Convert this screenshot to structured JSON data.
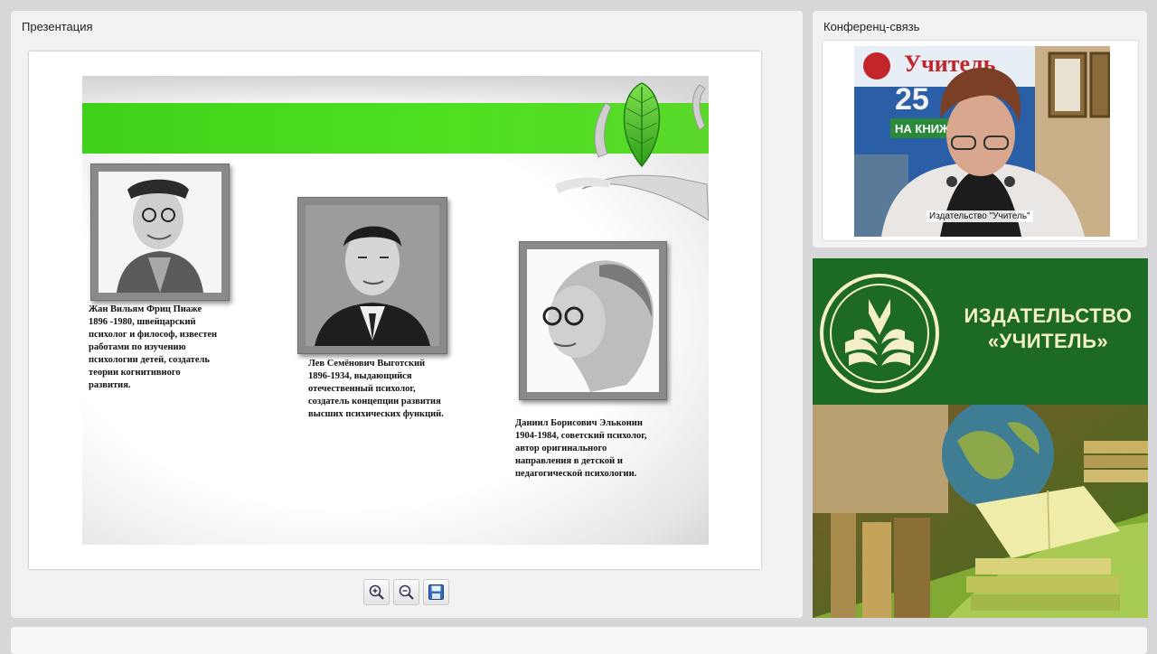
{
  "presentation": {
    "title": "Презентация",
    "slide": {
      "people": [
        {
          "caption": "Жан Вильям Фриц Пиаже\n1896 -1980, швейцарский\nпсихолог и философ, известен\nработами по изучению\nпсихологии детей, создатель\nтеории когнитивного\nразвития."
        },
        {
          "caption": "Лев Семёнович Выготский\n1896-1934, выдающийся\nотечественный психолог,\nсоздатель концепции развития\nвысших психических функций."
        },
        {
          "caption": "Даниил Борисович Эльконин\n1904-1984, советский психолог,\nавтор оригинального\nнаправления в детской и\nпедагогической психологии."
        }
      ]
    },
    "toolbar": {
      "zoom_in_icon": "zoom-in-icon",
      "zoom_out_icon": "zoom-out-icon",
      "save_icon": "floppy-disk-icon"
    }
  },
  "conference": {
    "title": "Конференц-связь",
    "video_label": "Издательство \"Учитель\"",
    "video_backdrop_text": {
      "brand": "Учитель",
      "number": "25",
      "subtitle": "НА КНИЖ"
    }
  },
  "publisher": {
    "name_line1": "ИЗДАТЕЛЬСТВО",
    "name_line2": "«УЧИТЕЛЬ»",
    "colors": {
      "band": "#1d6a23",
      "text": "#f4efc6"
    }
  },
  "colors": {
    "accent_green": "#4ee021",
    "panel_bg": "#f2f2f2",
    "page_bg": "#d7d7d9"
  }
}
